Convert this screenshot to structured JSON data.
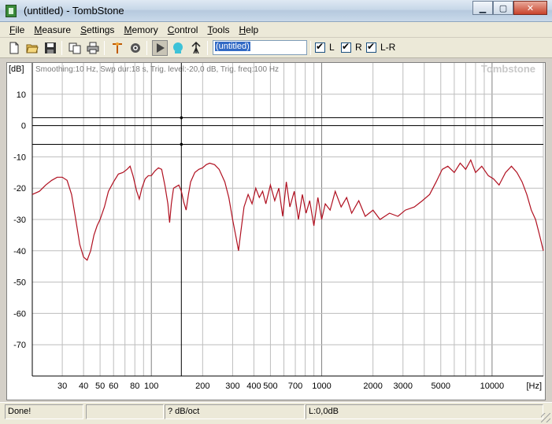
{
  "window": {
    "title": "(untitled) - TombStone",
    "minimize_icon": "minimize-icon",
    "maximize_icon": "maximize-icon",
    "close_icon": "close-icon"
  },
  "menu": [
    {
      "label": "File",
      "accel": "F",
      "rest": "ile"
    },
    {
      "label": "Measure",
      "accel": "M",
      "rest": "easure"
    },
    {
      "label": "Settings",
      "accel": "S",
      "rest": "ettings"
    },
    {
      "label": "Memory",
      "accel": "M",
      "rest": "emory"
    },
    {
      "label": "Control",
      "accel": "C",
      "rest": "ontrol"
    },
    {
      "label": "Tools",
      "accel": "T",
      "rest": "ools"
    },
    {
      "label": "Help",
      "accel": "H",
      "rest": "elp"
    }
  ],
  "toolbar": {
    "icons": [
      "new-file-icon",
      "open-folder-icon",
      "save-icon",
      "copy-icon",
      "print-icon",
      "marker-icon",
      "settings-gear-icon",
      "play-icon",
      "monitor-icon",
      "antenna-icon"
    ],
    "title_field_value": "(untitled)",
    "checkboxes": [
      {
        "label": "L",
        "checked": true
      },
      {
        "label": "R",
        "checked": true
      },
      {
        "label": "L-R",
        "checked": true
      }
    ]
  },
  "chart_data": {
    "type": "line",
    "info_text": "Smoothing:10 Hz, Swp dur:18 s, Trig. level:-20,0 dB, Trig. freq:100 Hz",
    "watermark": "Tombstone",
    "ylabel": "[dB]",
    "xlabel": "[Hz]",
    "y_unit_label": "[dB]",
    "x_unit_label": "[Hz]",
    "x_scale": "log",
    "xlim": [
      20,
      20000
    ],
    "ylim": [
      -80,
      20
    ],
    "y_ticks": [
      10,
      0,
      -10,
      -20,
      -30,
      -40,
      -50,
      -60,
      -70
    ],
    "x_tick_labels": [
      {
        "f": 30,
        "label": "30"
      },
      {
        "f": 40,
        "label": "40"
      },
      {
        "f": 50,
        "label": "50"
      },
      {
        "f": 60,
        "label": "60"
      },
      {
        "f": 80,
        "label": "80"
      },
      {
        "f": 100,
        "label": "100"
      },
      {
        "f": 200,
        "label": "200"
      },
      {
        "f": 300,
        "label": "300"
      },
      {
        "f": 400,
        "label": "400"
      },
      {
        "f": 500,
        "label": "500"
      },
      {
        "f": 700,
        "label": "700"
      },
      {
        "f": 1000,
        "label": "1000"
      },
      {
        "f": 2000,
        "label": "2000"
      },
      {
        "f": 3000,
        "label": "3000"
      },
      {
        "f": 5000,
        "label": "5000"
      },
      {
        "f": 10000,
        "label": "10000"
      }
    ],
    "grid": true,
    "markers": {
      "horizontal_db": [
        2.5,
        0,
        -6
      ],
      "vertical_freq": 150
    },
    "series": [
      {
        "color": "#b01020",
        "points": [
          [
            20,
            -22
          ],
          [
            22,
            -21
          ],
          [
            24,
            -19
          ],
          [
            26,
            -17.5
          ],
          [
            28,
            -16.5
          ],
          [
            30,
            -16.5
          ],
          [
            32,
            -17.5
          ],
          [
            34,
            -22
          ],
          [
            36,
            -30
          ],
          [
            38,
            -38
          ],
          [
            40,
            -42
          ],
          [
            42,
            -43
          ],
          [
            44,
            -40
          ],
          [
            46,
            -35
          ],
          [
            48,
            -32
          ],
          [
            50,
            -30
          ],
          [
            53,
            -26
          ],
          [
            56,
            -21
          ],
          [
            60,
            -18
          ],
          [
            64,
            -15.5
          ],
          [
            68,
            -15
          ],
          [
            72,
            -14
          ],
          [
            75,
            -13
          ],
          [
            78,
            -16
          ],
          [
            82,
            -21
          ],
          [
            85,
            -23.5
          ],
          [
            88,
            -20
          ],
          [
            92,
            -17
          ],
          [
            96,
            -16
          ],
          [
            100,
            -16
          ],
          [
            105,
            -14.5
          ],
          [
            110,
            -13.5
          ],
          [
            115,
            -14
          ],
          [
            120,
            -19
          ],
          [
            125,
            -25
          ],
          [
            128,
            -31
          ],
          [
            131,
            -25
          ],
          [
            135,
            -20
          ],
          [
            140,
            -19.5
          ],
          [
            145,
            -19
          ],
          [
            150,
            -21
          ],
          [
            155,
            -24.5
          ],
          [
            160,
            -27
          ],
          [
            165,
            -22
          ],
          [
            170,
            -18
          ],
          [
            180,
            -15
          ],
          [
            190,
            -14
          ],
          [
            200,
            -13.5
          ],
          [
            210,
            -12.5
          ],
          [
            220,
            -12
          ],
          [
            235,
            -12.5
          ],
          [
            250,
            -14
          ],
          [
            270,
            -18
          ],
          [
            285,
            -23
          ],
          [
            300,
            -30
          ],
          [
            315,
            -36
          ],
          [
            325,
            -40
          ],
          [
            335,
            -34
          ],
          [
            350,
            -26
          ],
          [
            370,
            -22
          ],
          [
            390,
            -25
          ],
          [
            410,
            -20
          ],
          [
            430,
            -23
          ],
          [
            450,
            -21
          ],
          [
            470,
            -25
          ],
          [
            500,
            -19
          ],
          [
            530,
            -24
          ],
          [
            560,
            -20
          ],
          [
            590,
            -29
          ],
          [
            620,
            -18
          ],
          [
            650,
            -26
          ],
          [
            690,
            -21
          ],
          [
            730,
            -30
          ],
          [
            770,
            -22
          ],
          [
            810,
            -28
          ],
          [
            850,
            -24
          ],
          [
            900,
            -32
          ],
          [
            950,
            -23
          ],
          [
            1000,
            -30
          ],
          [
            1050,
            -25
          ],
          [
            1120,
            -27
          ],
          [
            1200,
            -21
          ],
          [
            1300,
            -26
          ],
          [
            1400,
            -23
          ],
          [
            1500,
            -28
          ],
          [
            1650,
            -24
          ],
          [
            1800,
            -29
          ],
          [
            2000,
            -27
          ],
          [
            2200,
            -30
          ],
          [
            2500,
            -28
          ],
          [
            2800,
            -29
          ],
          [
            3100,
            -27
          ],
          [
            3500,
            -26
          ],
          [
            3900,
            -24
          ],
          [
            4300,
            -22
          ],
          [
            4700,
            -18
          ],
          [
            5100,
            -14
          ],
          [
            5500,
            -13
          ],
          [
            6000,
            -15
          ],
          [
            6500,
            -12
          ],
          [
            7000,
            -14
          ],
          [
            7500,
            -11
          ],
          [
            8000,
            -15
          ],
          [
            8700,
            -13
          ],
          [
            9500,
            -16
          ],
          [
            10200,
            -17
          ],
          [
            11000,
            -19
          ],
          [
            12000,
            -15
          ],
          [
            13000,
            -13
          ],
          [
            14000,
            -15
          ],
          [
            15000,
            -18
          ],
          [
            16000,
            -22
          ],
          [
            17000,
            -27
          ],
          [
            18000,
            -30
          ],
          [
            19000,
            -35
          ],
          [
            20000,
            -40
          ]
        ]
      }
    ]
  },
  "status": {
    "message": "Done!",
    "panel2": "",
    "units": "? dB/oct",
    "level": "L:0,0dB"
  }
}
